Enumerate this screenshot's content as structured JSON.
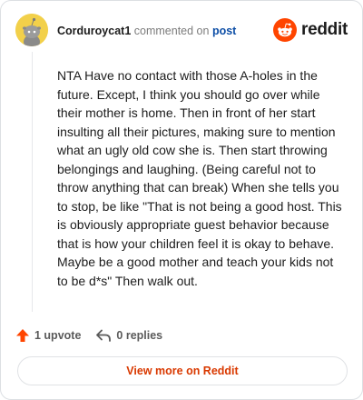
{
  "comment": {
    "username": "Corduroycat1",
    "action_text": "commented on",
    "post_link": "post",
    "body": "NTA Have no contact with those A-holes in the future. Except, I think you should go over while their mother is home. Then in front of her start insulting all their pictures, making sure to mention what an ugly old cow she is. Then start throwing belongings and laughing. (Being careful not to throw anything that can break) When she tells you to stop, be like \"That is not being a good host. This is obviously appropriate guest behavior because that is how your children feel it is okay to behave. Maybe be a good mother and teach your kids not to be d*s\" Then walk out.",
    "upvotes": "1 upvote",
    "replies": "0 replies"
  },
  "brand": {
    "name": "reddit",
    "color": "#ff4500"
  },
  "footer": {
    "view_more": "View more on Reddit"
  },
  "icons": {
    "avatar": "snoo-avatar",
    "logo": "reddit-alien-icon",
    "upvote": "upvote-arrow-icon",
    "reply": "reply-arrow-icon"
  }
}
